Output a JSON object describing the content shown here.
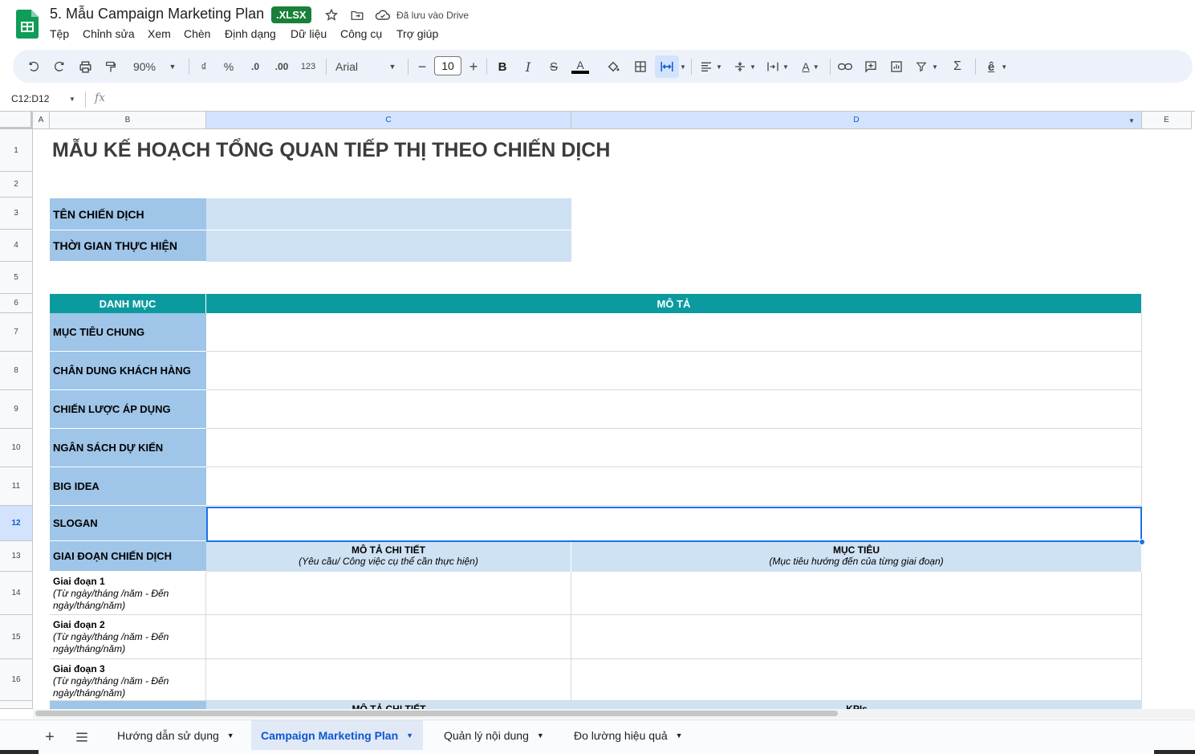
{
  "header": {
    "doc_title": "5. Mẫu Campaign Marketing Plan",
    "file_badge": ".XLSX",
    "saved_status": "Đã lưu vào Drive",
    "menu": [
      "Tệp",
      "Chỉnh sửa",
      "Xem",
      "Chèn",
      "Định dạng",
      "Dữ liệu",
      "Công cụ",
      "Trợ giúp"
    ]
  },
  "toolbar": {
    "zoom": "90%",
    "currency": "₫",
    "percent": "%",
    "dec_decrease": ".0",
    "dec_increase": ".00",
    "number_format": "123",
    "font": "Arial",
    "font_size": "10",
    "icons": [
      "undo-icon",
      "redo-icon",
      "print-icon",
      "paint-format-icon",
      "bold-icon",
      "italic-icon",
      "strikethrough-icon",
      "text-color-icon",
      "fill-color-icon",
      "borders-icon",
      "merge-cells-icon",
      "align-icon",
      "valign-icon",
      "wrap-icon",
      "rotate-icon",
      "link-icon",
      "comment-icon",
      "chart-icon",
      "filter-icon",
      "functions-icon",
      "input-tools-icon"
    ]
  },
  "formula_bar": {
    "name_box": "C12:D12",
    "fx": "fx",
    "value": ""
  },
  "grid": {
    "columns": [
      "A",
      "B",
      "C",
      "D",
      "E"
    ],
    "rows": [
      "1",
      "2",
      "3",
      "4",
      "5",
      "6",
      "7",
      "8",
      "9",
      "10",
      "11",
      "12",
      "13",
      "14",
      "15",
      "16"
    ]
  },
  "sheet": {
    "title": "MẪU KẾ HOẠCH TỔNG QUAN TIẾP THỊ THEO CHIẾN DỊCH",
    "campaign_name_label": "TÊN CHIẾN DỊCH",
    "campaign_time_label": "THỜI GIAN THỰC HIỆN",
    "col_category": "DANH MỤC",
    "col_description": "MÔ TẢ",
    "categories": [
      "MỤC TIÊU CHUNG",
      "CHÂN DUNG KHÁCH HÀNG",
      "CHIẾN LƯỢC ÁP DỤNG",
      "NGÂN SÁCH DỰ KIẾN",
      "BIG IDEA",
      "SLOGAN"
    ],
    "phase_label": "GIAI ĐOẠN CHIẾN DỊCH",
    "phase_detail_title": "MÔ TẢ CHI TIẾT",
    "phase_detail_sub": "(Yêu cầu/ Công việc cụ thể cần thực hiện)",
    "phase_goal_title": "MỤC TIÊU",
    "phase_goal_sub": "(Mục tiêu hướng đến của từng giai đoạn)",
    "phases": [
      {
        "name": "Giai đoạn 1",
        "range": "(Từ ngày/tháng /năm - Đến ngày/tháng/năm)"
      },
      {
        "name": "Giai đoạn 2",
        "range": "(Từ ngày/tháng /năm - Đến ngày/tháng/năm)"
      },
      {
        "name": "Giai đoạn 3",
        "range": "(Từ ngày/tháng /năm - Đến ngày/tháng/năm)"
      }
    ],
    "partial_row_c": "MÔ TẢ CHI TIẾT",
    "partial_row_d": "KPIs"
  },
  "tabs": [
    "Hướng dẫn sử dụng",
    "Campaign Marketing Plan",
    "Quản lý nội dung",
    "Đo lường hiệu quả"
  ],
  "colors": {
    "teal_header": "#0b9b9f",
    "label_blue": "#9fc5e8",
    "light_blue": "#cfe2f3",
    "selection": "#1a73e8",
    "xlsx_green": "#188038"
  }
}
